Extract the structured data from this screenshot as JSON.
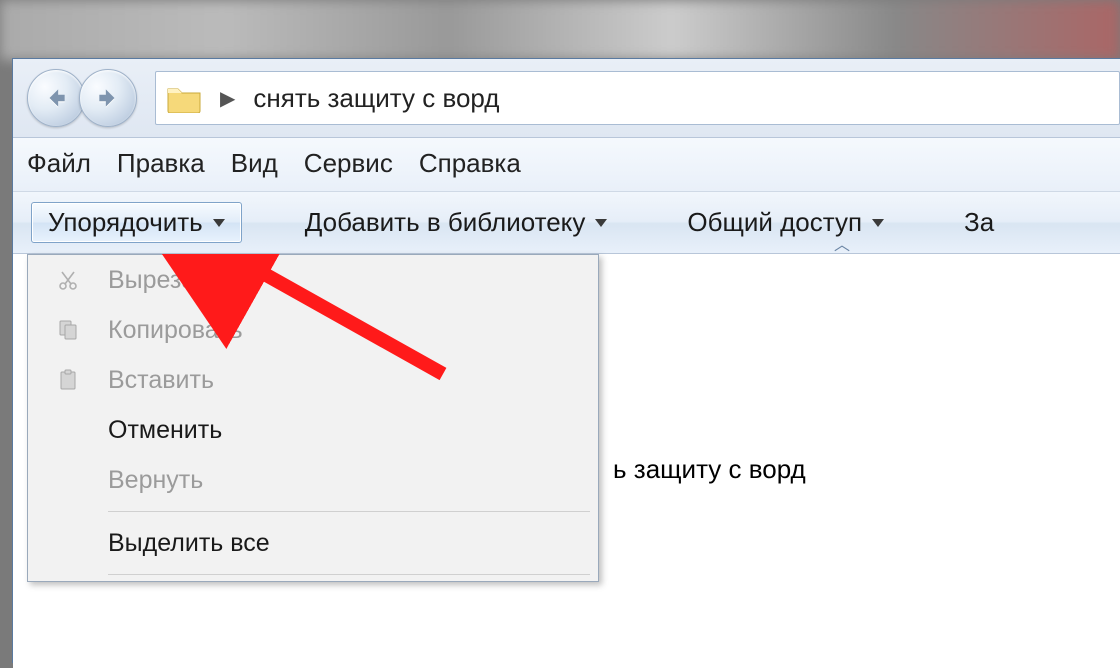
{
  "address": {
    "path_label": "снять защиту с ворд"
  },
  "menubar": {
    "items": [
      "Файл",
      "Правка",
      "Вид",
      "Сервис",
      "Справка"
    ]
  },
  "toolbar": {
    "organize": "Упорядочить",
    "add_library": "Добавить в библиотеку",
    "share": "Общий доступ",
    "last_partial": "За"
  },
  "dropdown": {
    "cut": "Вырезать",
    "copy": "Копировать",
    "paste": "Вставить",
    "undo": "Отменить",
    "redo": "Вернуть",
    "select_all": "Выделить все"
  },
  "content": {
    "filename_fragment": "ь защиту с ворд"
  }
}
